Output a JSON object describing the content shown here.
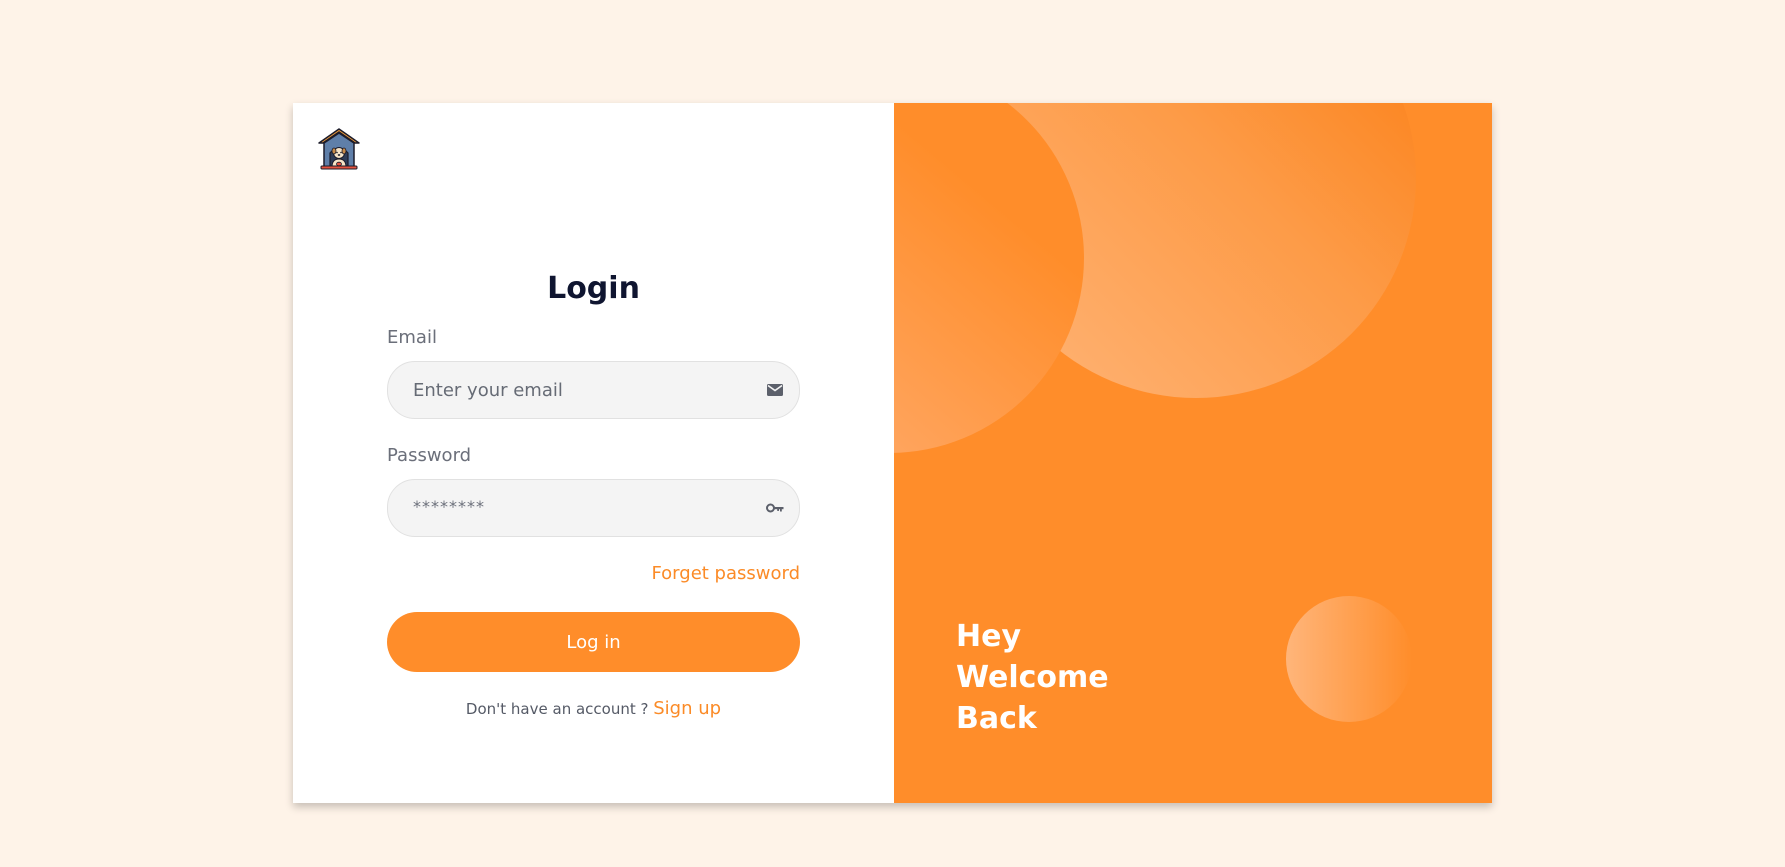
{
  "login": {
    "title": "Login",
    "email_label": "Email",
    "email_placeholder": "Enter your email",
    "password_label": "Password",
    "password_value": "********",
    "forgot_label": "Forget password",
    "login_button": "Log in",
    "no_account_text": "Don't have an account ?",
    "signup_link": "Sign up"
  },
  "welcome": {
    "line1": "Hey",
    "line2": "Welcome",
    "line3": "Back"
  },
  "icons": {
    "logo": "doghouse-logo",
    "email": "mail-icon",
    "password": "key-icon"
  },
  "colors": {
    "accent": "#ff8d2a",
    "page_background": "#fef3e8",
    "title": "#0f1530"
  }
}
